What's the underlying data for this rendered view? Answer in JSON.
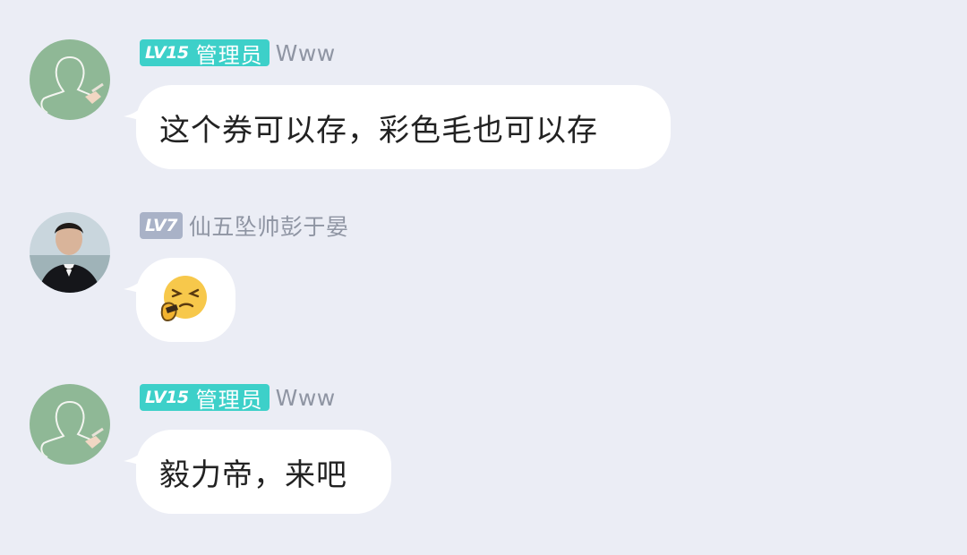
{
  "colors": {
    "background": "#ebedf5",
    "admin_badge": "#3dd0c9",
    "level_badge": "#a9b2c7",
    "name_text": "#8f95a3",
    "bubble": "#ffffff"
  },
  "messages": [
    {
      "avatar_icon": "pencil-sketch-avatar-icon",
      "level": "LV15",
      "role": "管理员",
      "name": "Www",
      "text": "这个券可以存，彩色毛也可以存"
    },
    {
      "avatar_icon": "tuxedo-man-photo-avatar",
      "level": "LV7",
      "role": "",
      "name": "仙五坠帅彭于晏",
      "emoji_icon": "squinting-face-emoji-icon"
    },
    {
      "avatar_icon": "pencil-sketch-avatar-icon",
      "level": "LV15",
      "role": "管理员",
      "name": "Www",
      "text": "毅力帝，来吧"
    }
  ]
}
